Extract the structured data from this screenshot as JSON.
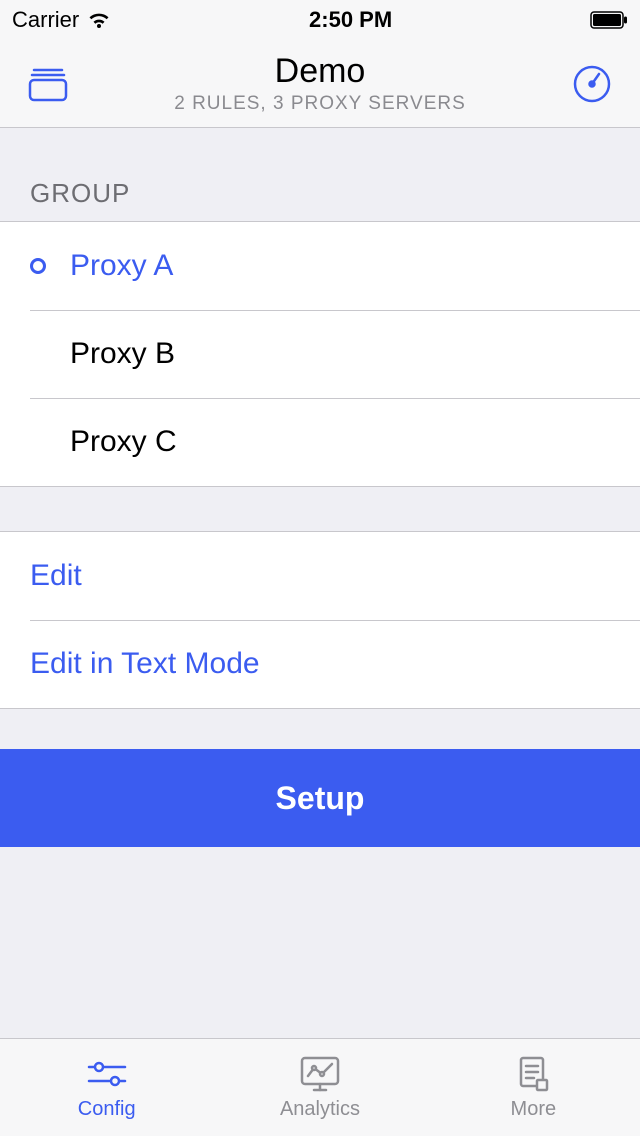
{
  "statusBar": {
    "carrier": "Carrier",
    "time": "2:50 PM"
  },
  "header": {
    "title": "Demo",
    "subtitle": "2 RULES, 3 PROXY SERVERS"
  },
  "group": {
    "label": "GROUP",
    "items": [
      {
        "label": "Proxy A",
        "selected": true
      },
      {
        "label": "Proxy B",
        "selected": false
      },
      {
        "label": "Proxy C",
        "selected": false
      }
    ]
  },
  "actions": {
    "edit": "Edit",
    "editText": "Edit in Text Mode"
  },
  "setup": {
    "label": "Setup"
  },
  "tabs": [
    {
      "label": "Config",
      "active": true
    },
    {
      "label": "Analytics",
      "active": false
    },
    {
      "label": "More",
      "active": false
    }
  ],
  "colors": {
    "accent": "#3b5cf0"
  }
}
